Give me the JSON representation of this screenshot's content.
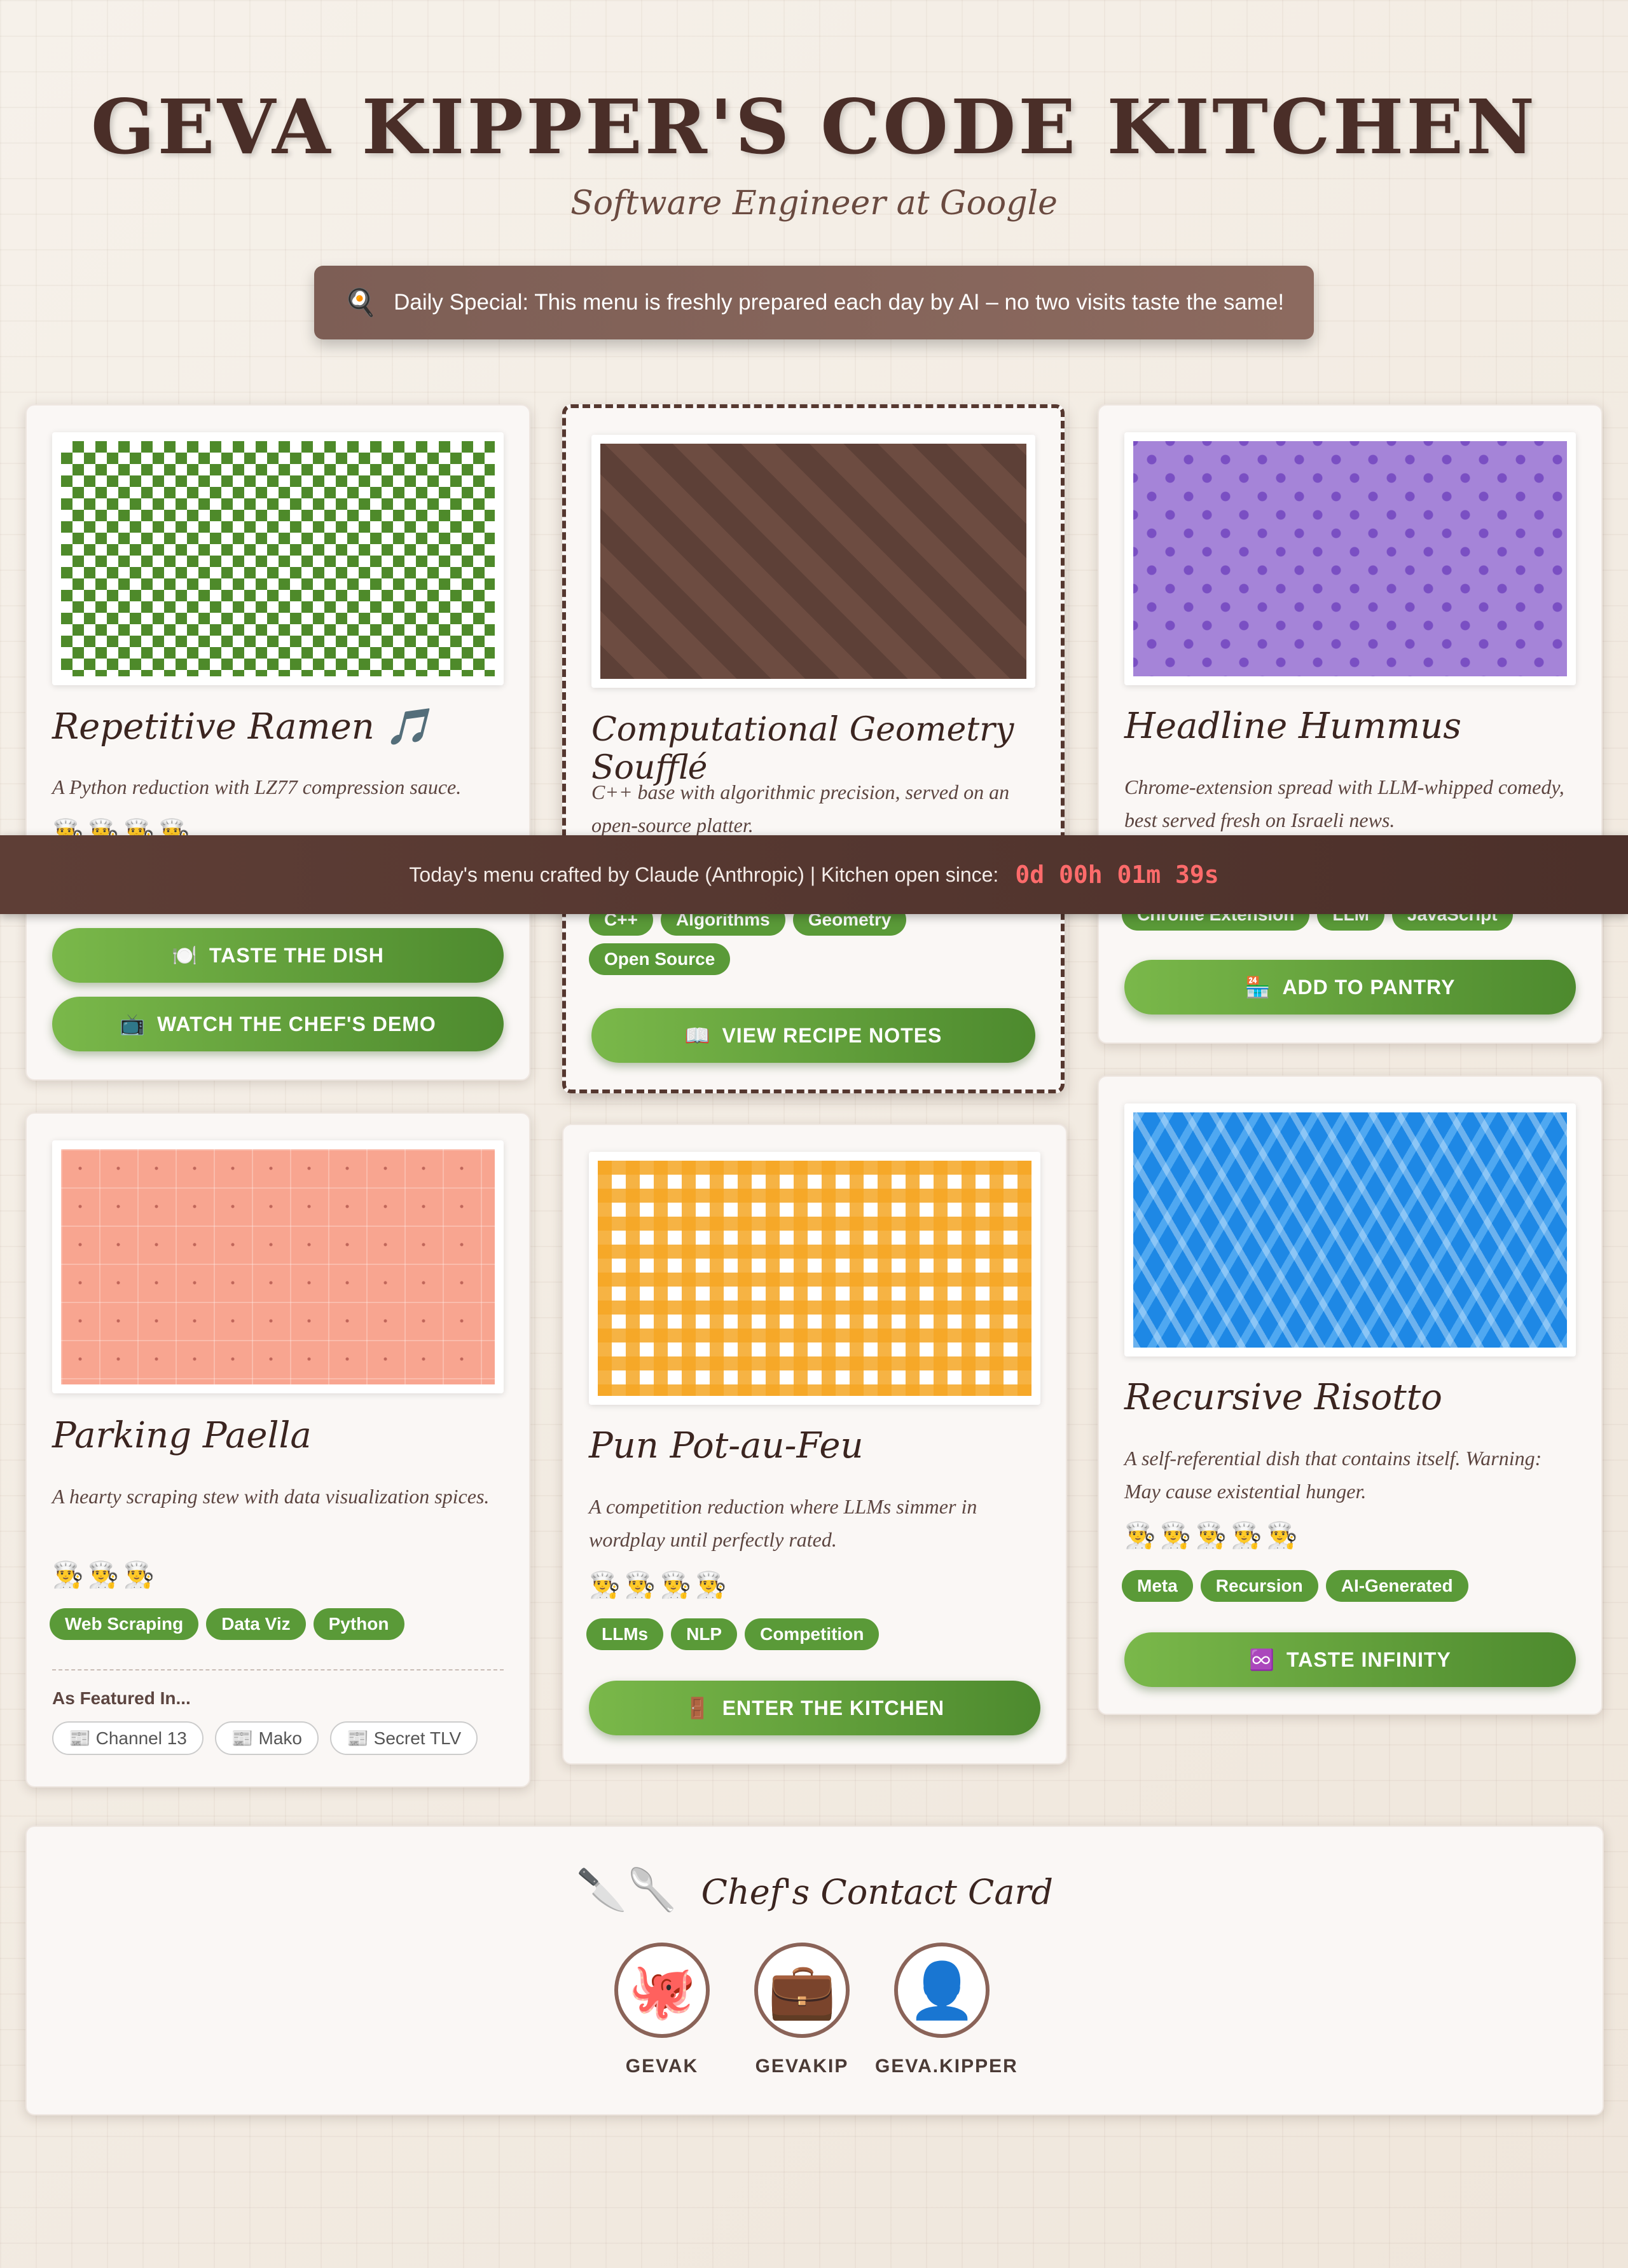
{
  "header": {
    "title": "GEVA KIPPER'S CODE KITCHEN",
    "subtitle": "Software Engineer at Google",
    "special_icon": "🍳",
    "special_text": "Daily Special: This menu is freshly prepared each day by AI – no two visits taste the same!"
  },
  "banner": {
    "text": "Today's menu crafted by Claude (Anthropic) | Kitchen open since:",
    "timer": "0d 00h 01m 39s"
  },
  "dishes": {
    "ramen": {
      "title": "Repetitive Ramen 🎵",
      "desc": "A Python reduction with LZ77 compression sauce.",
      "hats": "👨‍🍳👨‍🍳👨‍🍳👨‍🍳",
      "btn1_icon": "🍽️",
      "btn1": "TASTE THE DISH",
      "btn2_icon": "📺",
      "btn2": "WATCH THE CHEF'S DEMO",
      "pattern": "green-checker"
    },
    "souffle": {
      "title": "Computational Geometry Soufflé",
      "desc": "C++ base with algorithmic precision, served on an open-source platter.",
      "tags": [
        "C++",
        "Algorithms",
        "Geometry",
        "Open Source"
      ],
      "btn_icon": "📖",
      "btn": "VIEW RECIPE NOTES",
      "pattern": "brown-stripes"
    },
    "hummus": {
      "title": "Headline Hummus",
      "desc": "Chrome-extension spread with LLM-whipped comedy, best served fresh on Israeli news.",
      "tags": [
        "Chrome Extension",
        "LLM",
        "JavaScript"
      ],
      "btn_icon": "🏪",
      "btn": "ADD TO PANTRY",
      "pattern": "purple-dots"
    },
    "paella": {
      "title": "Parking Paella",
      "desc": "A hearty scraping stew with data visualization spices.",
      "hats": "👨‍🍳👨‍🍳👨‍🍳",
      "tags": [
        "Web Scraping",
        "Data Viz",
        "Python"
      ],
      "featured_label": "As Featured In...",
      "press": [
        "📰 Channel 13",
        "📰 Mako",
        "📰 Secret TLV"
      ],
      "pattern": "salmon-grid"
    },
    "potaufeu": {
      "title": "Pun Pot-au-Feu",
      "desc": "A competition reduction where LLMs simmer in wordplay until perfectly rated.",
      "hats": "👨‍🍳👨‍🍳👨‍🍳👨‍🍳",
      "tags": [
        "LLMs",
        "NLP",
        "Competition"
      ],
      "btn_icon": "🚪",
      "btn": "ENTER THE KITCHEN",
      "pattern": "orange-gingham"
    },
    "risotto": {
      "title": "Recursive Risotto",
      "desc": "A self-referential dish that contains itself. Warning: May cause existential hunger.",
      "hats": "👨‍🍳👨‍🍳👨‍🍳👨‍🍳👨‍🍳",
      "tags": [
        "Meta",
        "Recursion",
        "AI-Generated"
      ],
      "btn_icon": "♾️",
      "btn": "TASTE INFINITY",
      "pattern": "blue-diagonal"
    }
  },
  "contact": {
    "icon": "🔪🥄",
    "title": "Chef's Contact Card",
    "links": [
      {
        "icon": "🐙",
        "name": "GEVAK"
      },
      {
        "icon": "💼",
        "name": "GEVAKIP"
      },
      {
        "icon": "👤",
        "name": "GEVA.KIPPER"
      }
    ]
  },
  "colors": {
    "accent_green": "#5a9a38",
    "brown": "#5e3e36",
    "timer_red": "#ff6b6b"
  }
}
